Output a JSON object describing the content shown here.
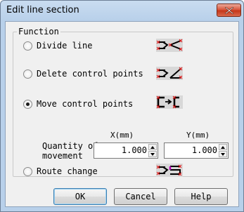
{
  "window": {
    "title": "Edit line section"
  },
  "group": {
    "title": "Function"
  },
  "options": {
    "divide": {
      "label": "Divide line",
      "checked": false
    },
    "delete": {
      "label": "Delete control points",
      "checked": false
    },
    "move": {
      "label": "Move control points",
      "checked": true
    },
    "route": {
      "label": "Route change",
      "checked": false
    }
  },
  "movement": {
    "label": "Quantity of movement",
    "x_unit": "X(mm)",
    "y_unit": "Y(mm)",
    "x_value": "1.000",
    "y_value": "1.000"
  },
  "buttons": {
    "ok": "OK",
    "cancel": "Cancel",
    "help": "Help"
  },
  "icons": {
    "close": "close-icon",
    "divide": "divide-line-icon",
    "delete": "delete-control-points-icon",
    "move": "move-control-points-icon",
    "route": "route-change-icon"
  },
  "colors": {
    "title_bar": "#b9d1ea",
    "close_button": "#d0472b",
    "marker_red": "#e02020",
    "dialog_bg": "#f0f0f0"
  }
}
